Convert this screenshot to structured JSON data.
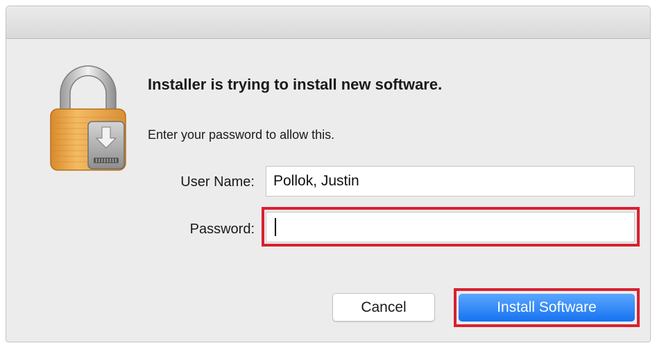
{
  "dialog": {
    "heading": "Installer is trying to install new software.",
    "instruction": "Enter your password to allow this.",
    "icon": "lock-installer-icon"
  },
  "form": {
    "username_label": "User Name:",
    "username_value": "Pollok, Justin",
    "password_label": "Password:",
    "password_value": ""
  },
  "buttons": {
    "cancel_label": "Cancel",
    "install_label": "Install Software"
  },
  "colors": {
    "highlight": "#d9202f",
    "accent": "#1572f0",
    "lock_gold": "#e9a64c"
  }
}
